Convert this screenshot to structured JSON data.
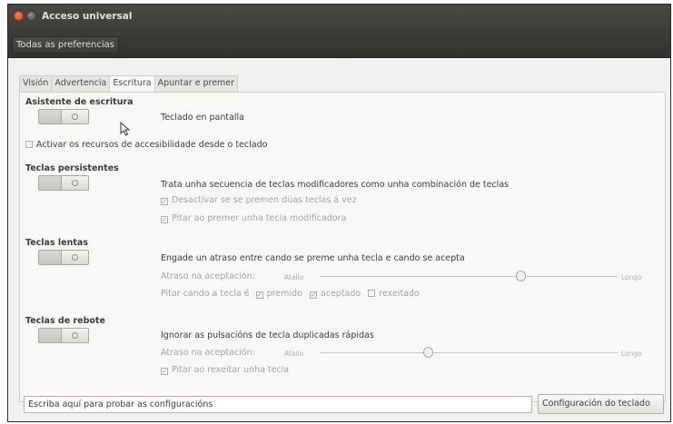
{
  "window": {
    "title": "Acceso universal"
  },
  "toolbar": {
    "all_prefs": "Todas as preferencias"
  },
  "tabs": [
    {
      "label": "Visión",
      "active": false
    },
    {
      "label": "Advertencia",
      "active": false
    },
    {
      "label": "Escritura",
      "active": true
    },
    {
      "label": "Apuntar e premer",
      "active": false
    }
  ],
  "typing_assistant": {
    "heading": "Asistente de escritura",
    "description": "Teclado en pantalla",
    "keyboard_activation": "Activar os recursos de accesibilidade desde o teclado"
  },
  "sticky_keys": {
    "heading": "Teclas persistentes",
    "description": "Trata unha secuencia de teclas modificadores como unha combinación de teclas",
    "option1": "Desactivar se se premen dúas teclas á vez",
    "option2": "Pitar ao premer unha tecla modificadora"
  },
  "slow_keys": {
    "heading": "Teclas lentas",
    "description": "Engade un atraso entre cando se preme unha tecla e cando se acepta",
    "delay_label": "Atraso na aceptación:",
    "short": "Atallo",
    "long": "Longo",
    "delay_value": 0.68,
    "beep_label": "Pitar cando a tecla é",
    "pressed": "premido",
    "accepted": "aceptado",
    "rejected": "rexeitado"
  },
  "bounce_keys": {
    "heading": "Teclas de rebote",
    "description": "Ignorar as pulsacións de tecla duplicadas rápidas",
    "delay_label": "Atraso na aceptación:",
    "short": "Atallo",
    "long": "Longo",
    "delay_value": 0.36,
    "beep_label": "Pitar ao rexeitar unha tecla"
  },
  "footer": {
    "test_placeholder": "Escriba aquí para probar as configuracións",
    "keyboard_settings": "Configuración do teclado"
  },
  "colors": {
    "close_button": "#e0461b",
    "titlebar": "#3c3b37",
    "panel": "#f9f8f6"
  }
}
